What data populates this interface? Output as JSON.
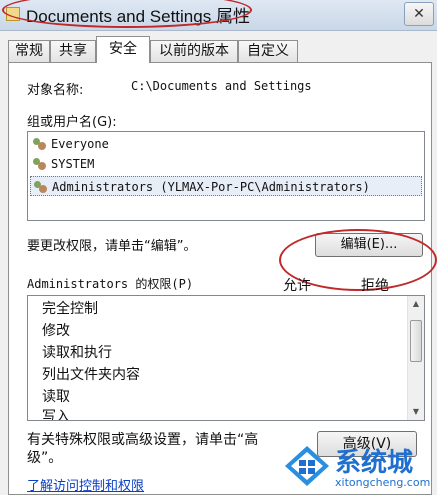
{
  "window": {
    "title": "Documents and Settings 属性",
    "close_label": "✕"
  },
  "tabs": [
    {
      "label": "常规"
    },
    {
      "label": "共享"
    },
    {
      "label": "安全"
    },
    {
      "label": "以前的版本"
    },
    {
      "label": "自定义"
    }
  ],
  "security": {
    "object_name_label": "对象名称:",
    "object_name_value": "C:\\Documents and Settings",
    "groups_label": "组或用户名(G):",
    "users": [
      {
        "name": "Everyone"
      },
      {
        "name": "SYSTEM"
      },
      {
        "name": "Administrators (YLMAX-Por-PC\\Administrators)"
      }
    ],
    "change_hint": "要更改权限，请单击“编辑”。",
    "edit_button": "编辑(E)...",
    "permissions_label": "Administrators 的权限(P)",
    "allow_header": "允许",
    "deny_header": "拒绝",
    "permissions": [
      {
        "name": "完全控制"
      },
      {
        "name": "修改"
      },
      {
        "name": "读取和执行"
      },
      {
        "name": "列出文件夹内容"
      },
      {
        "name": "读取"
      },
      {
        "name": "写入"
      }
    ],
    "advanced_hint_line1": "有关特殊权限或高级设置，请单击“高",
    "advanced_hint_line2": "级”。",
    "advanced_button": "高级(V)",
    "learn_link": "了解访问控制和权限"
  },
  "watermark": {
    "text": "系统城",
    "url": "xitongcheng.com",
    "brand_color": "#1e6fd0"
  }
}
